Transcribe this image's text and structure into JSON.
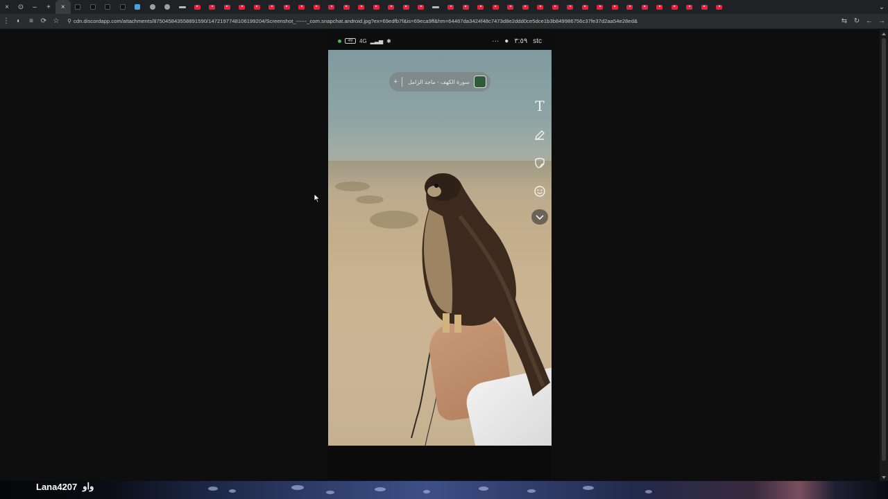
{
  "browser": {
    "url": "cdn.discordapp.com/attachments/875045843558891590/1472197748106199204/Screenshot_------_com.snapchat.android.jpg?ex=69edfb7f&is=69eca9ff&hm=64467da3424f48c7473d8e2ddd0ce5dce1b3b849986756c37fe37d2aa54e28ed&",
    "tabs": [
      "tiktok",
      "tiktok",
      "tiktok",
      "tiktok",
      "blue",
      "grok",
      "gray",
      "wide",
      "yt",
      "yt",
      "yt",
      "yt",
      "yt",
      "yt",
      "yt",
      "yt",
      "yt",
      "yt",
      "yt",
      "yt",
      "yt",
      "yt",
      "yt",
      "yt",
      "wide",
      "yt",
      "yt",
      "yt",
      "yt",
      "yt",
      "yt",
      "yt",
      "yt",
      "yt",
      "yt",
      "yt",
      "yt",
      "yt",
      "yt",
      "yt",
      "yt",
      "yt",
      "yt",
      "yt"
    ],
    "icons": {
      "close": "×",
      "new_tab": "+",
      "menu": "⋮",
      "back": "←",
      "forward": "→",
      "reload": "↻"
    }
  },
  "phone": {
    "status": {
      "battery": "49",
      "carrier": "stc",
      "time": "٣:٥٩",
      "dots": "···",
      "network": "4G"
    },
    "music_chip": {
      "plus": "+",
      "title": "سورة الكهف - ماجد الزامل"
    },
    "tools": {
      "text_tool": "T"
    }
  },
  "stream_overlay": {
    "username": "Lana4207",
    "message": "واو"
  },
  "colors": {
    "accent_youtube": "#e8203a",
    "status_green": "#3cc24b"
  }
}
